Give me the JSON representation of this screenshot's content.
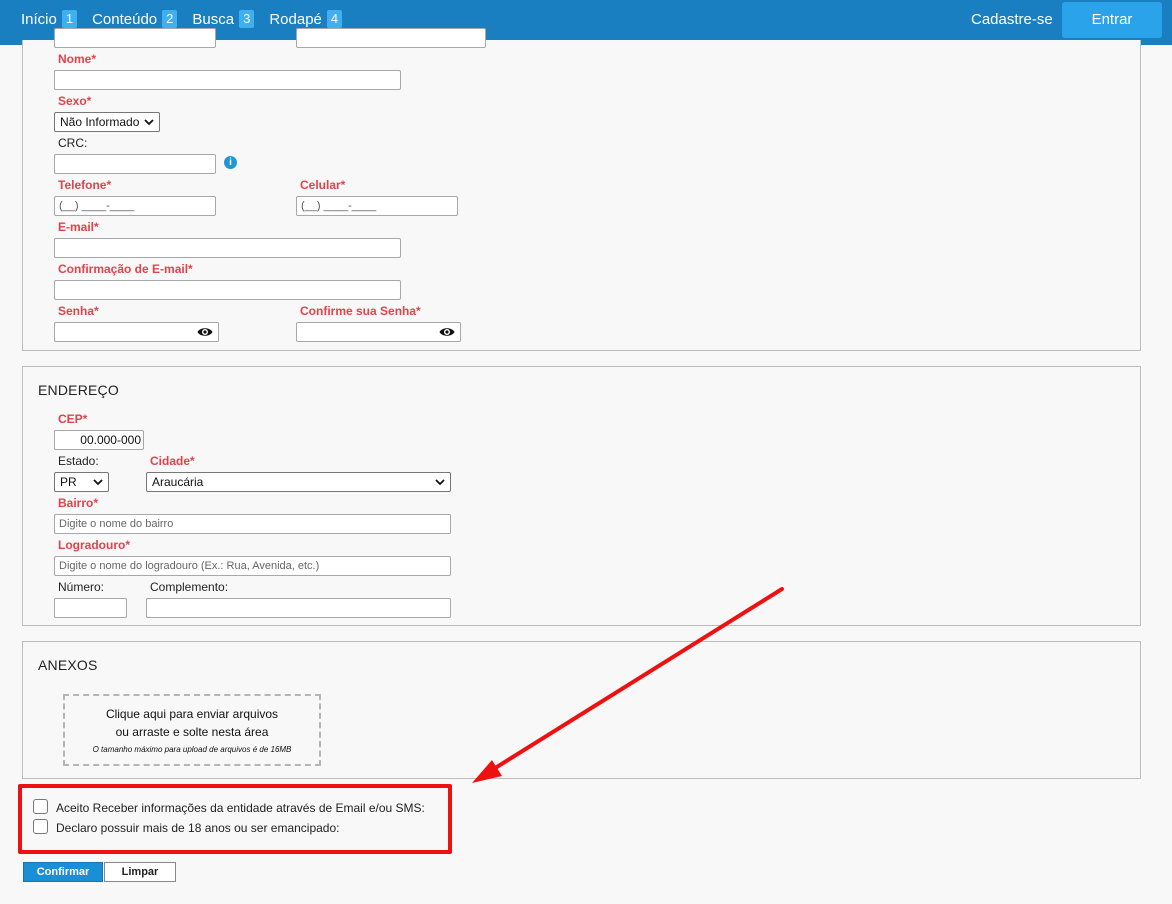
{
  "topnav": {
    "items": [
      {
        "label": "Início",
        "num": "1"
      },
      {
        "label": "Conteúdo",
        "num": "2"
      },
      {
        "label": "Busca",
        "num": "3"
      },
      {
        "label": "Rodapé",
        "num": "4"
      }
    ],
    "signup": "Cadastre-se",
    "login": "Entrar"
  },
  "personal": {
    "name_label": "Nome*",
    "sex_label": "Sexo*",
    "sex_value": "Não Informado",
    "crc_label": "CRC:",
    "crc_info": "i",
    "phone_label": "Telefone*",
    "phone_placeholder": "(__) ____-____",
    "cell_label": "Celular*",
    "cell_placeholder": "(__) ____-____",
    "email_label": "E-mail*",
    "email_confirm_label": "Confirmação de E-mail*",
    "password_label": "Senha*",
    "password_confirm_label": "Confirme sua Senha*"
  },
  "address": {
    "title": "ENDEREÇO",
    "cep_label": "CEP*",
    "cep_value": "00.000-000",
    "state_label": "Estado:",
    "state_value": "PR",
    "city_label": "Cidade*",
    "city_value": "Araucária",
    "district_label": "Bairro*",
    "district_placeholder": "Digite o nome do bairro",
    "street_label": "Logradouro*",
    "street_placeholder": "Digite o nome do logradouro (Ex.: Rua, Avenida, etc.)",
    "number_label": "Número:",
    "complement_label": "Complemento:"
  },
  "attachments": {
    "title": "ANEXOS",
    "drop_line1": "Clique aqui para enviar arquivos",
    "drop_line2": "ou arraste e solte nesta área",
    "drop_note": "O tamanho máximo para upload de arquivos é de 16MB"
  },
  "consent": {
    "receive_info": "Aceito Receber informações da entidade através de Email e/ou SMS:",
    "of_age": "Declaro possuir mais de 18 anos ou ser emancipado:"
  },
  "actions": {
    "confirm": "Confirmar",
    "clear": "Limpar"
  },
  "colors": {
    "topbar": "#1a7fc1",
    "required_label": "#e0434a",
    "annotation": "#ee1111"
  }
}
